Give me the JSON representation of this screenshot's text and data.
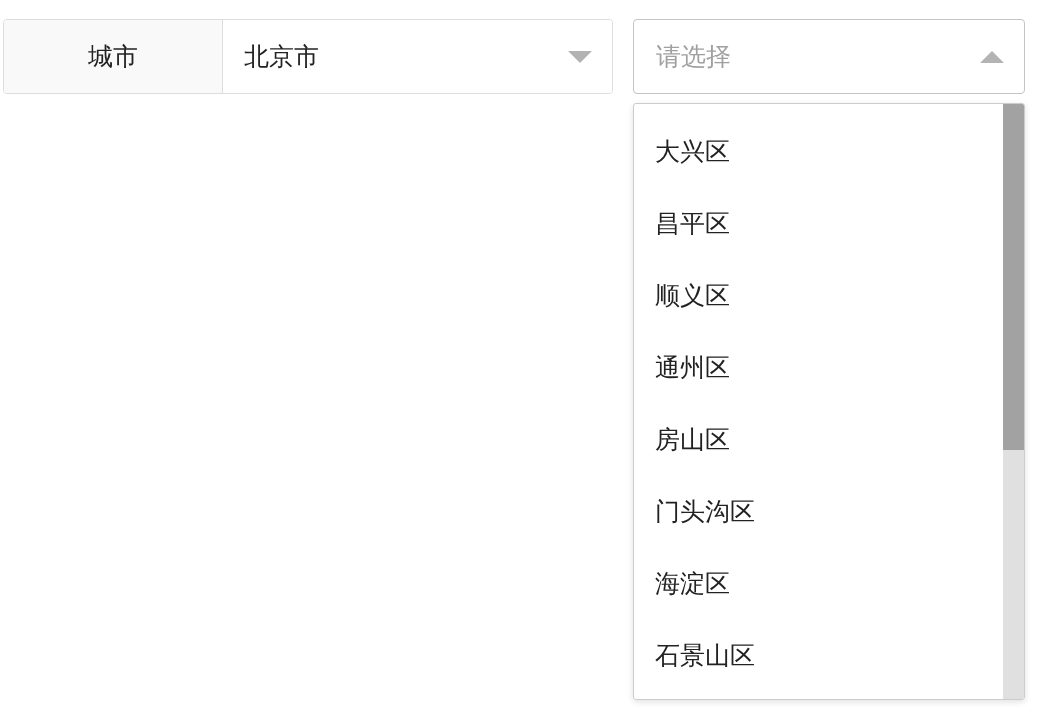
{
  "city_filter": {
    "label": "城市",
    "value": "北京市",
    "expanded": false
  },
  "district_select": {
    "placeholder": "请选择",
    "expanded": true
  },
  "options": [
    {
      "label": "大兴区"
    },
    {
      "label": "昌平区"
    },
    {
      "label": "顺义区"
    },
    {
      "label": "通州区"
    },
    {
      "label": "房山区"
    },
    {
      "label": "门头沟区"
    },
    {
      "label": "海淀区"
    },
    {
      "label": "石景山区"
    }
  ]
}
